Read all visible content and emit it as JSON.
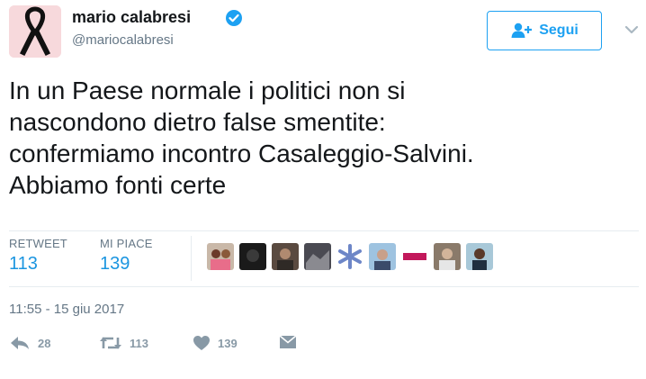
{
  "user": {
    "name": "mario calabresi",
    "handle": "@mariocalabresi"
  },
  "follow_button": {
    "label": "Segui"
  },
  "tweet": {
    "lines": [
      "In un Paese normale i politici non si",
      "nascondono dietro false smentite:",
      "confermiamo incontro Casaleggio-Salvini.",
      "Abbiamo fonti certe"
    ]
  },
  "stats": {
    "retweet_label": "RETWEET",
    "retweet_count": "113",
    "likes_label": "MI PIACE",
    "likes_count": "139"
  },
  "liker_avatars": [
    "avatar-1",
    "avatar-2",
    "avatar-3",
    "avatar-4",
    "avatar-5",
    "avatar-6",
    "avatar-7",
    "avatar-8",
    "avatar-9"
  ],
  "timestamp": "11:55 - 15 giu 2017",
  "actions": {
    "reply_count": "28",
    "retweet_count": "113",
    "like_count": "139"
  },
  "colors": {
    "accent": "#1da1f2",
    "count_blue": "#1b95e0",
    "muted": "#657786",
    "action_gray": "#8899a6"
  }
}
